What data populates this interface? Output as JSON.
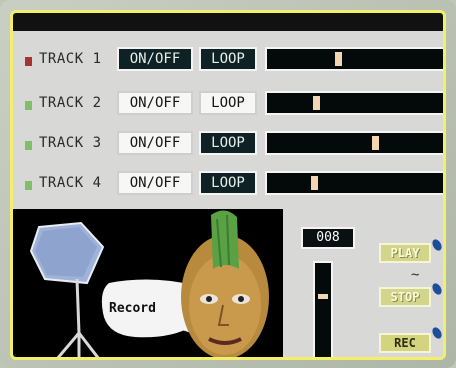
{
  "colors": {
    "border": "#f2f06a",
    "led_red": "#a83232",
    "led_green": "#7fbf6a"
  },
  "tracks": [
    {
      "label": "TRACK 1",
      "onoff": "ON/OFF",
      "loop": "LOOP",
      "led": "red",
      "level": 0.4
    },
    {
      "label": "TRACK 2",
      "onoff": "ON/OFF",
      "loop": "LOOP",
      "led": "green",
      "level": 0.27
    },
    {
      "label": "TRACK 3",
      "onoff": "ON/OFF",
      "loop": "LOOP",
      "led": "green",
      "level": 0.62
    },
    {
      "label": "TRACK 4",
      "onoff": "ON/OFF",
      "loop": "LOOP",
      "led": "green",
      "level": 0.26
    }
  ],
  "scene": {
    "bubble_text": "Record"
  },
  "transport": {
    "counter": "008",
    "play": "PLAY",
    "stop": "STOP",
    "rec": "REC",
    "volume_level": 0.33
  }
}
